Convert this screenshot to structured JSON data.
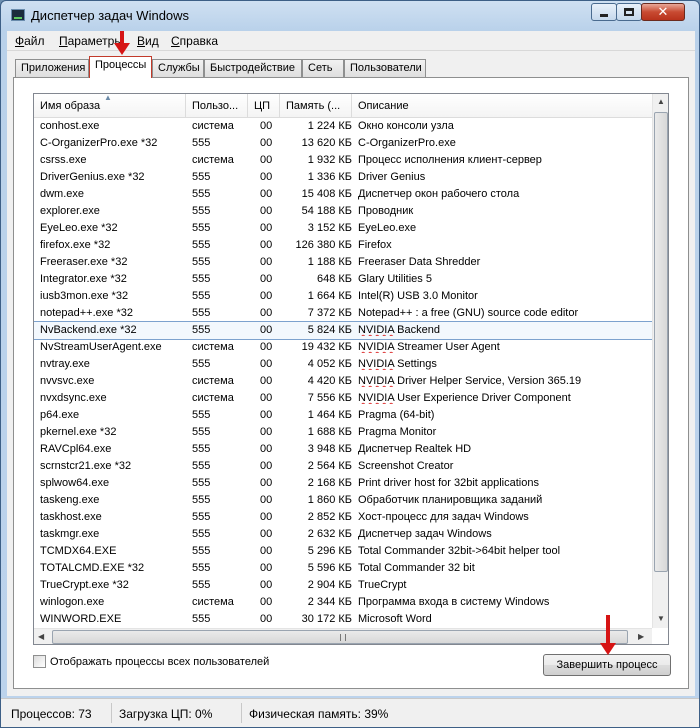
{
  "window": {
    "title": "Диспетчер задач Windows",
    "close_glyph": "✕"
  },
  "menu": [
    "Файл",
    "Параметры",
    "Вид",
    "Справка"
  ],
  "tabs": [
    {
      "label": "Приложения"
    },
    {
      "label": "Процессы",
      "active": true
    },
    {
      "label": "Службы"
    },
    {
      "label": "Быстродействие"
    },
    {
      "label": "Сеть"
    },
    {
      "label": "Пользователи"
    }
  ],
  "columns": {
    "name": "Имя образа",
    "user": "Пользо...",
    "cpu": "ЦП",
    "memory": "Память (...",
    "description": "Описание"
  },
  "processes": [
    {
      "name": "conhost.exe",
      "user": "система",
      "cpu": "00",
      "memory": "1 224 КБ",
      "description": "Окно консоли узла"
    },
    {
      "name": "C-OrganizerPro.exe *32",
      "user": "555",
      "cpu": "00",
      "memory": "13 620 КБ",
      "description": "C-OrganizerPro.exe"
    },
    {
      "name": "csrss.exe",
      "user": "система",
      "cpu": "00",
      "memory": "1 932 КБ",
      "description": "Процесс исполнения клиент-сервер"
    },
    {
      "name": "DriverGenius.exe *32",
      "user": "555",
      "cpu": "00",
      "memory": "1 336 КБ",
      "description": "Driver Genius"
    },
    {
      "name": "dwm.exe",
      "user": "555",
      "cpu": "00",
      "memory": "15 408 КБ",
      "description": "Диспетчер окон рабочего стола"
    },
    {
      "name": "explorer.exe",
      "user": "555",
      "cpu": "00",
      "memory": "54 188 КБ",
      "description": "Проводник"
    },
    {
      "name": "EyeLeo.exe *32",
      "user": "555",
      "cpu": "00",
      "memory": "3 152 КБ",
      "description": "EyeLeo.exe"
    },
    {
      "name": "firefox.exe *32",
      "user": "555",
      "cpu": "00",
      "memory": "126 380 КБ",
      "description": "Firefox"
    },
    {
      "name": "Freeraser.exe *32",
      "user": "555",
      "cpu": "00",
      "memory": "1 188 КБ",
      "description": "Freeraser Data Shredder"
    },
    {
      "name": "Integrator.exe *32",
      "user": "555",
      "cpu": "00",
      "memory": "648 КБ",
      "description": "Glary Utilities 5"
    },
    {
      "name": "iusb3mon.exe *32",
      "user": "555",
      "cpu": "00",
      "memory": "1 664 КБ",
      "description": "Intel(R) USB 3.0 Monitor"
    },
    {
      "name": "notepad++.exe *32",
      "user": "555",
      "cpu": "00",
      "memory": "7 372 КБ",
      "description": "Notepad++ : a free (GNU) source code editor"
    },
    {
      "name": "NvBackend.exe *32",
      "user": "555",
      "cpu": "00",
      "memory": "5 824 КБ",
      "description": "NVIDIA Backend",
      "selected": true
    },
    {
      "name": "NvStreamUserAgent.exe",
      "user": "система",
      "cpu": "00",
      "memory": "19 432 КБ",
      "description": "NVIDIA Streamer User Agent"
    },
    {
      "name": "nvtray.exe",
      "user": "555",
      "cpu": "00",
      "memory": "4 052 КБ",
      "description": "NVIDIA Settings"
    },
    {
      "name": "nvvsvc.exe",
      "user": "система",
      "cpu": "00",
      "memory": "4 420 КБ",
      "description": "NVIDIA Driver Helper Service, Version 365.19"
    },
    {
      "name": "nvxdsync.exe",
      "user": "система",
      "cpu": "00",
      "memory": "7 556 КБ",
      "description": "NVIDIA User Experience Driver Component"
    },
    {
      "name": "p64.exe",
      "user": "555",
      "cpu": "00",
      "memory": "1 464 КБ",
      "description": "Pragma (64-bit)"
    },
    {
      "name": "pkernel.exe *32",
      "user": "555",
      "cpu": "00",
      "memory": "1 688 КБ",
      "description": "Pragma Monitor"
    },
    {
      "name": "RAVCpl64.exe",
      "user": "555",
      "cpu": "00",
      "memory": "3 948 КБ",
      "description": "Диспетчер Realtek HD"
    },
    {
      "name": "scrnstcr21.exe *32",
      "user": "555",
      "cpu": "00",
      "memory": "2 564 КБ",
      "description": "Screenshot Creator"
    },
    {
      "name": "splwow64.exe",
      "user": "555",
      "cpu": "00",
      "memory": "2 168 КБ",
      "description": "Print driver host for 32bit applications"
    },
    {
      "name": "taskeng.exe",
      "user": "555",
      "cpu": "00",
      "memory": "1 860 КБ",
      "description": "Обработчик планировщика заданий"
    },
    {
      "name": "taskhost.exe",
      "user": "555",
      "cpu": "00",
      "memory": "2 852 КБ",
      "description": "Хост-процесс для задач Windows"
    },
    {
      "name": "taskmgr.exe",
      "user": "555",
      "cpu": "00",
      "memory": "2 632 КБ",
      "description": "Диспетчер задач Windows"
    },
    {
      "name": "TCMDX64.EXE",
      "user": "555",
      "cpu": "00",
      "memory": "5 296 КБ",
      "description": "Total Commander 32bit->64bit helper tool"
    },
    {
      "name": "TOTALCMD.EXE *32",
      "user": "555",
      "cpu": "00",
      "memory": "5 596 КБ",
      "description": "Total Commander 32 bit"
    },
    {
      "name": "TrueCrypt.exe *32",
      "user": "555",
      "cpu": "00",
      "memory": "2 904 КБ",
      "description": "TrueCrypt"
    },
    {
      "name": "winlogon.exe",
      "user": "система",
      "cpu": "00",
      "memory": "2 344 КБ",
      "description": "Программа входа в систему Windows"
    },
    {
      "name": "WINWORD.EXE",
      "user": "555",
      "cpu": "00",
      "memory": "30 172 КБ",
      "description": "Microsoft Word"
    }
  ],
  "show_all_users_label": "Отображать процессы всех пользователей",
  "end_process_label": "Завершить процесс",
  "status": {
    "processes": "Процессов: 73",
    "cpu_load": "Загрузка ЦП: 0%",
    "physical_memory": "Физическая память: 39%"
  },
  "colors": {
    "annotation_arrow": "#d61414",
    "active_tab_border": "#c23a2a",
    "selection_border": "#7da2ce"
  }
}
